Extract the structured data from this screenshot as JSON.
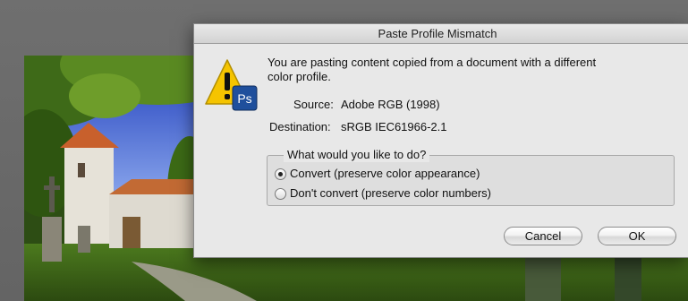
{
  "dialog": {
    "title": "Paste Profile Mismatch",
    "icon": "alert-photoshop-icon",
    "icon_badge": "Ps",
    "message": "You are pasting content copied from a document with a different color profile.",
    "source_label": "Source:",
    "source_value": "Adobe RGB (1998)",
    "destination_label": "Destination:",
    "destination_value": "sRGB IEC61966-2.1",
    "group_label": "What would you like to do?",
    "options": [
      {
        "label": "Convert (preserve color appearance)",
        "selected": true
      },
      {
        "label": "Don't convert (preserve color numbers)",
        "selected": false
      }
    ],
    "cancel_label": "Cancel",
    "ok_label": "OK"
  },
  "colors": {
    "warning_yellow": "#f5c400",
    "photoshop_blue": "#1f4f9c",
    "dialog_bg": "#e8e8e8"
  }
}
